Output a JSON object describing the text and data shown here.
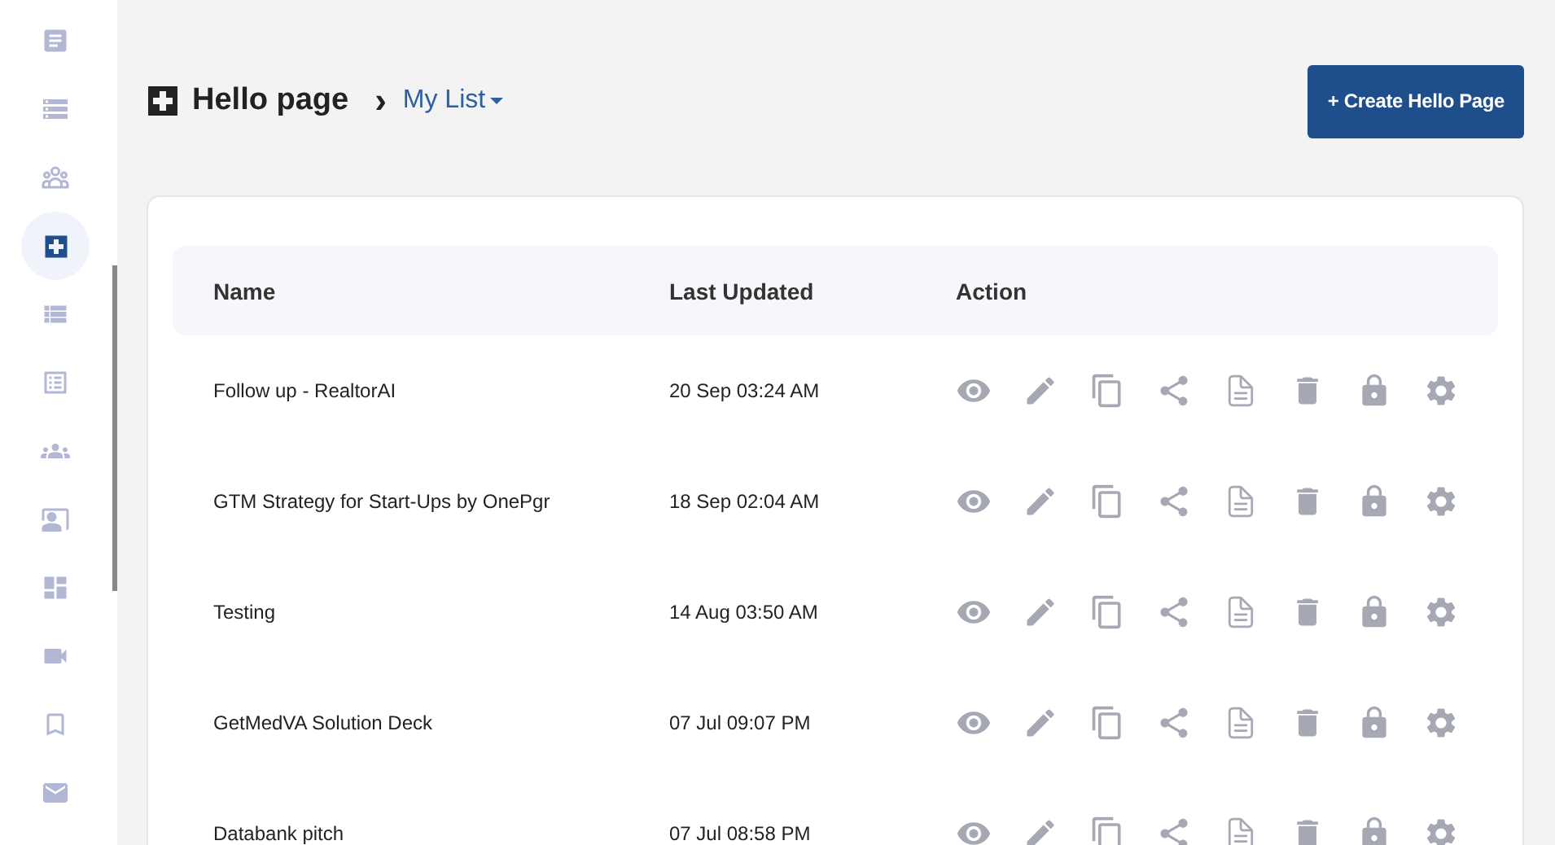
{
  "sidebar": {
    "items": [
      {
        "selected": false
      },
      {
        "selected": false
      },
      {
        "selected": false
      },
      {
        "selected": true
      },
      {
        "selected": false
      },
      {
        "selected": false
      },
      {
        "selected": false
      },
      {
        "selected": false
      },
      {
        "selected": false
      },
      {
        "selected": false
      },
      {
        "selected": false
      },
      {
        "selected": false
      }
    ]
  },
  "header": {
    "title": "Hello page",
    "separator": "›",
    "list_selector": "My List",
    "create_button": "+ Create Hello Page"
  },
  "table": {
    "columns": [
      "Name",
      "Last Updated",
      "Action"
    ],
    "rows": [
      {
        "name": "Follow up - RealtorAI",
        "last_updated": "20 Sep 03:24 AM"
      },
      {
        "name": "GTM Strategy for Start-Ups by OnePgr",
        "last_updated": "18 Sep 02:04 AM"
      },
      {
        "name": "Testing",
        "last_updated": "14 Aug 03:50 AM"
      },
      {
        "name": "GetMedVA Solution Deck",
        "last_updated": "07 Jul 09:07 PM"
      },
      {
        "name": "Databank pitch",
        "last_updated": "07 Jul 08:58 PM"
      }
    ]
  }
}
